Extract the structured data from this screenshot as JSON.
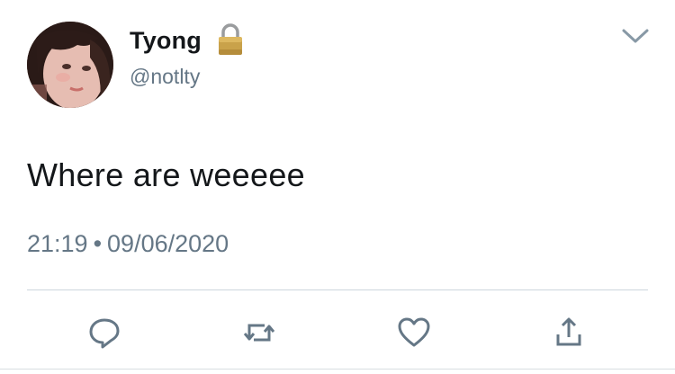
{
  "user": {
    "display_name": "Tyong",
    "handle": "@notlty",
    "avatar_icon": "profile-photo",
    "protected_icon": "lock-icon"
  },
  "tweet": {
    "text": "Where are weeeee",
    "time": "21:19",
    "separator": "•",
    "date": "09/06/2020"
  },
  "actions": {
    "menu_icon": "chevron-down-icon",
    "reply_icon": "reply-icon",
    "retweet_icon": "retweet-icon",
    "like_icon": "heart-icon",
    "share_icon": "share-icon"
  },
  "colors": {
    "text": "#14171a",
    "secondary": "#657786",
    "icon": "#657786",
    "divider": "#ccd6dd",
    "lock_gold": "#c9a24a"
  }
}
